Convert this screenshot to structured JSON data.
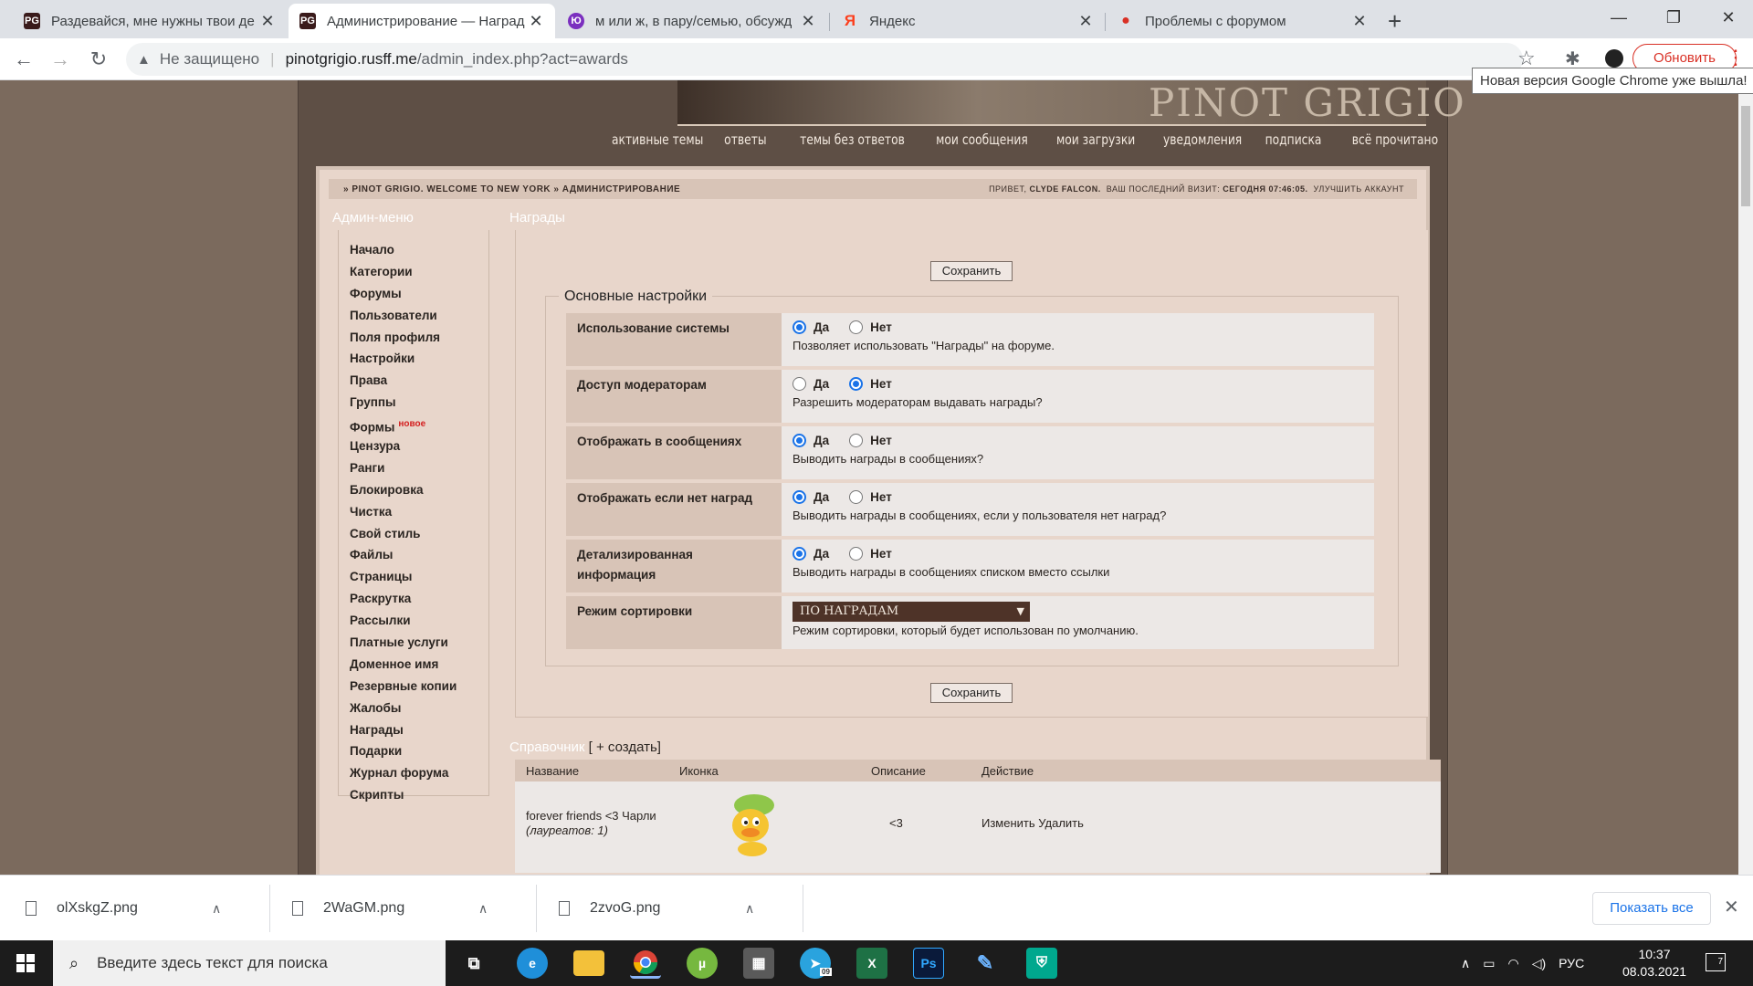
{
  "browser": {
    "tabs": [
      {
        "title": "Раздевайся, мне нужны твои де",
        "favicon": "PG",
        "favicon_color": "#3a1b1b",
        "active": false
      },
      {
        "title": "Администрирование — Наград",
        "favicon": "PG",
        "favicon_color": "#3a1b1b",
        "active": true
      },
      {
        "title": "м или ж, в пару/семью, обсужд",
        "favicon": "Ю",
        "favicon_color": "#7b2fbf",
        "active": false
      },
      {
        "title": "Яндекс",
        "favicon": "Я",
        "favicon_color": "#ffffff",
        "active": false
      },
      {
        "title": "Проблемы с форумом",
        "favicon": "●",
        "favicon_color": "#ffffff",
        "active": false
      }
    ],
    "new_tab_icon": "plus-icon",
    "window_controls": {
      "minimize": "—",
      "maximize": "❐",
      "close": "✕"
    },
    "address": {
      "not_secure_label": "Не защищено",
      "host": "pinotgrigio.rusff.me",
      "path": "/admin_index.php?act=awards"
    },
    "update_button": "Обновить",
    "tooltip": "Новая версия Google Chrome уже вышла!"
  },
  "site": {
    "banner_title": "PINOT GRIGIO",
    "topnav": [
      "активные темы",
      "ответы",
      "темы без ответов",
      "мои сообщения",
      "мои загрузки",
      "уведомления",
      "подписка",
      "всё прочитано"
    ],
    "breadcrumb": "» PINOT GRIGIO. WELCOME TO NEW YORK » АДМИНИСТРИРОВАНИЕ",
    "userinfo": {
      "greeting": "Привет,",
      "username": "Clyde Falcon.",
      "last_visit_label": "Ваш последний визит:",
      "last_visit_value": "Сегодня 07:46:05.",
      "improve_label": "Улучшить аккаунт"
    }
  },
  "admin_menu": {
    "title": "Админ-меню",
    "items": [
      "Начало",
      "Категории",
      "Форумы",
      "Пользователи",
      "Поля профиля",
      "Настройки",
      "Права",
      "Группы",
      "Формы",
      "Цензура",
      "Ранги",
      "Блокировка",
      "Чистка",
      "Свой стиль",
      "Файлы",
      "Страницы",
      "Раскрутка",
      "Рассылки",
      "Платные услуги",
      "Доменное имя",
      "Резервные копии",
      "Жалобы",
      "Награды",
      "Подарки",
      "Журнал форума",
      "Скрипты"
    ],
    "new_badge": "новое"
  },
  "awards": {
    "title": "Награды",
    "save_label": "Сохранить",
    "fieldset_legend": "Основные настройки",
    "yes_label": "Да",
    "no_label": "Нет",
    "settings": [
      {
        "label": "Использование системы",
        "value": "yes",
        "desc": "Позволяет использовать \"Награды\" на форуме."
      },
      {
        "label": "Доступ модераторам",
        "value": "no",
        "desc": "Разрешить модераторам выдавать награды?"
      },
      {
        "label": "Отображать в сообщениях",
        "value": "yes",
        "desc": "Выводить награды в сообщениях?"
      },
      {
        "label": "Отображать если нет наград",
        "value": "yes",
        "desc": "Выводить награды в сообщениях, если у пользователя нет наград?"
      },
      {
        "label": "Детализированная информация",
        "value": "yes",
        "desc": "Выводить награды в сообщениях списком вместо ссылки"
      }
    ],
    "sort": {
      "label": "Режим сортировки",
      "selected": "ПО НАГРАДАМ",
      "desc": "Режим сортировки, который будет использован по умолчанию."
    }
  },
  "reference": {
    "title": "Справочник",
    "create_label": "[ + создать]",
    "columns": [
      "Название",
      "Иконка",
      "Описание",
      "Действие"
    ],
    "rows": [
      {
        "name": "forever friends <3 Чарли",
        "laureates": "(лауреатов: 1)",
        "icon": "duck-icon",
        "desc": "<3",
        "edit": "Изменить",
        "delete": "Удалить"
      }
    ]
  },
  "downloads": {
    "files": [
      "olXskgZ.png",
      "2WaGM.png",
      "2zvoG.png"
    ],
    "show_all": "Показать все"
  },
  "taskbar": {
    "search_placeholder": "Введите здесь текст для поиска",
    "apps": [
      "task-view-icon",
      "edge-icon",
      "explorer-icon",
      "chrome-icon",
      "utorrent-icon",
      "calculator-icon",
      "telegram-icon",
      "excel-icon",
      "photoshop-icon",
      "paint-icon",
      "kaspersky-icon"
    ],
    "telegram_badge": "09",
    "language": "РУС",
    "time": "10:37",
    "date": "08.03.2021",
    "notification_count": "7"
  }
}
